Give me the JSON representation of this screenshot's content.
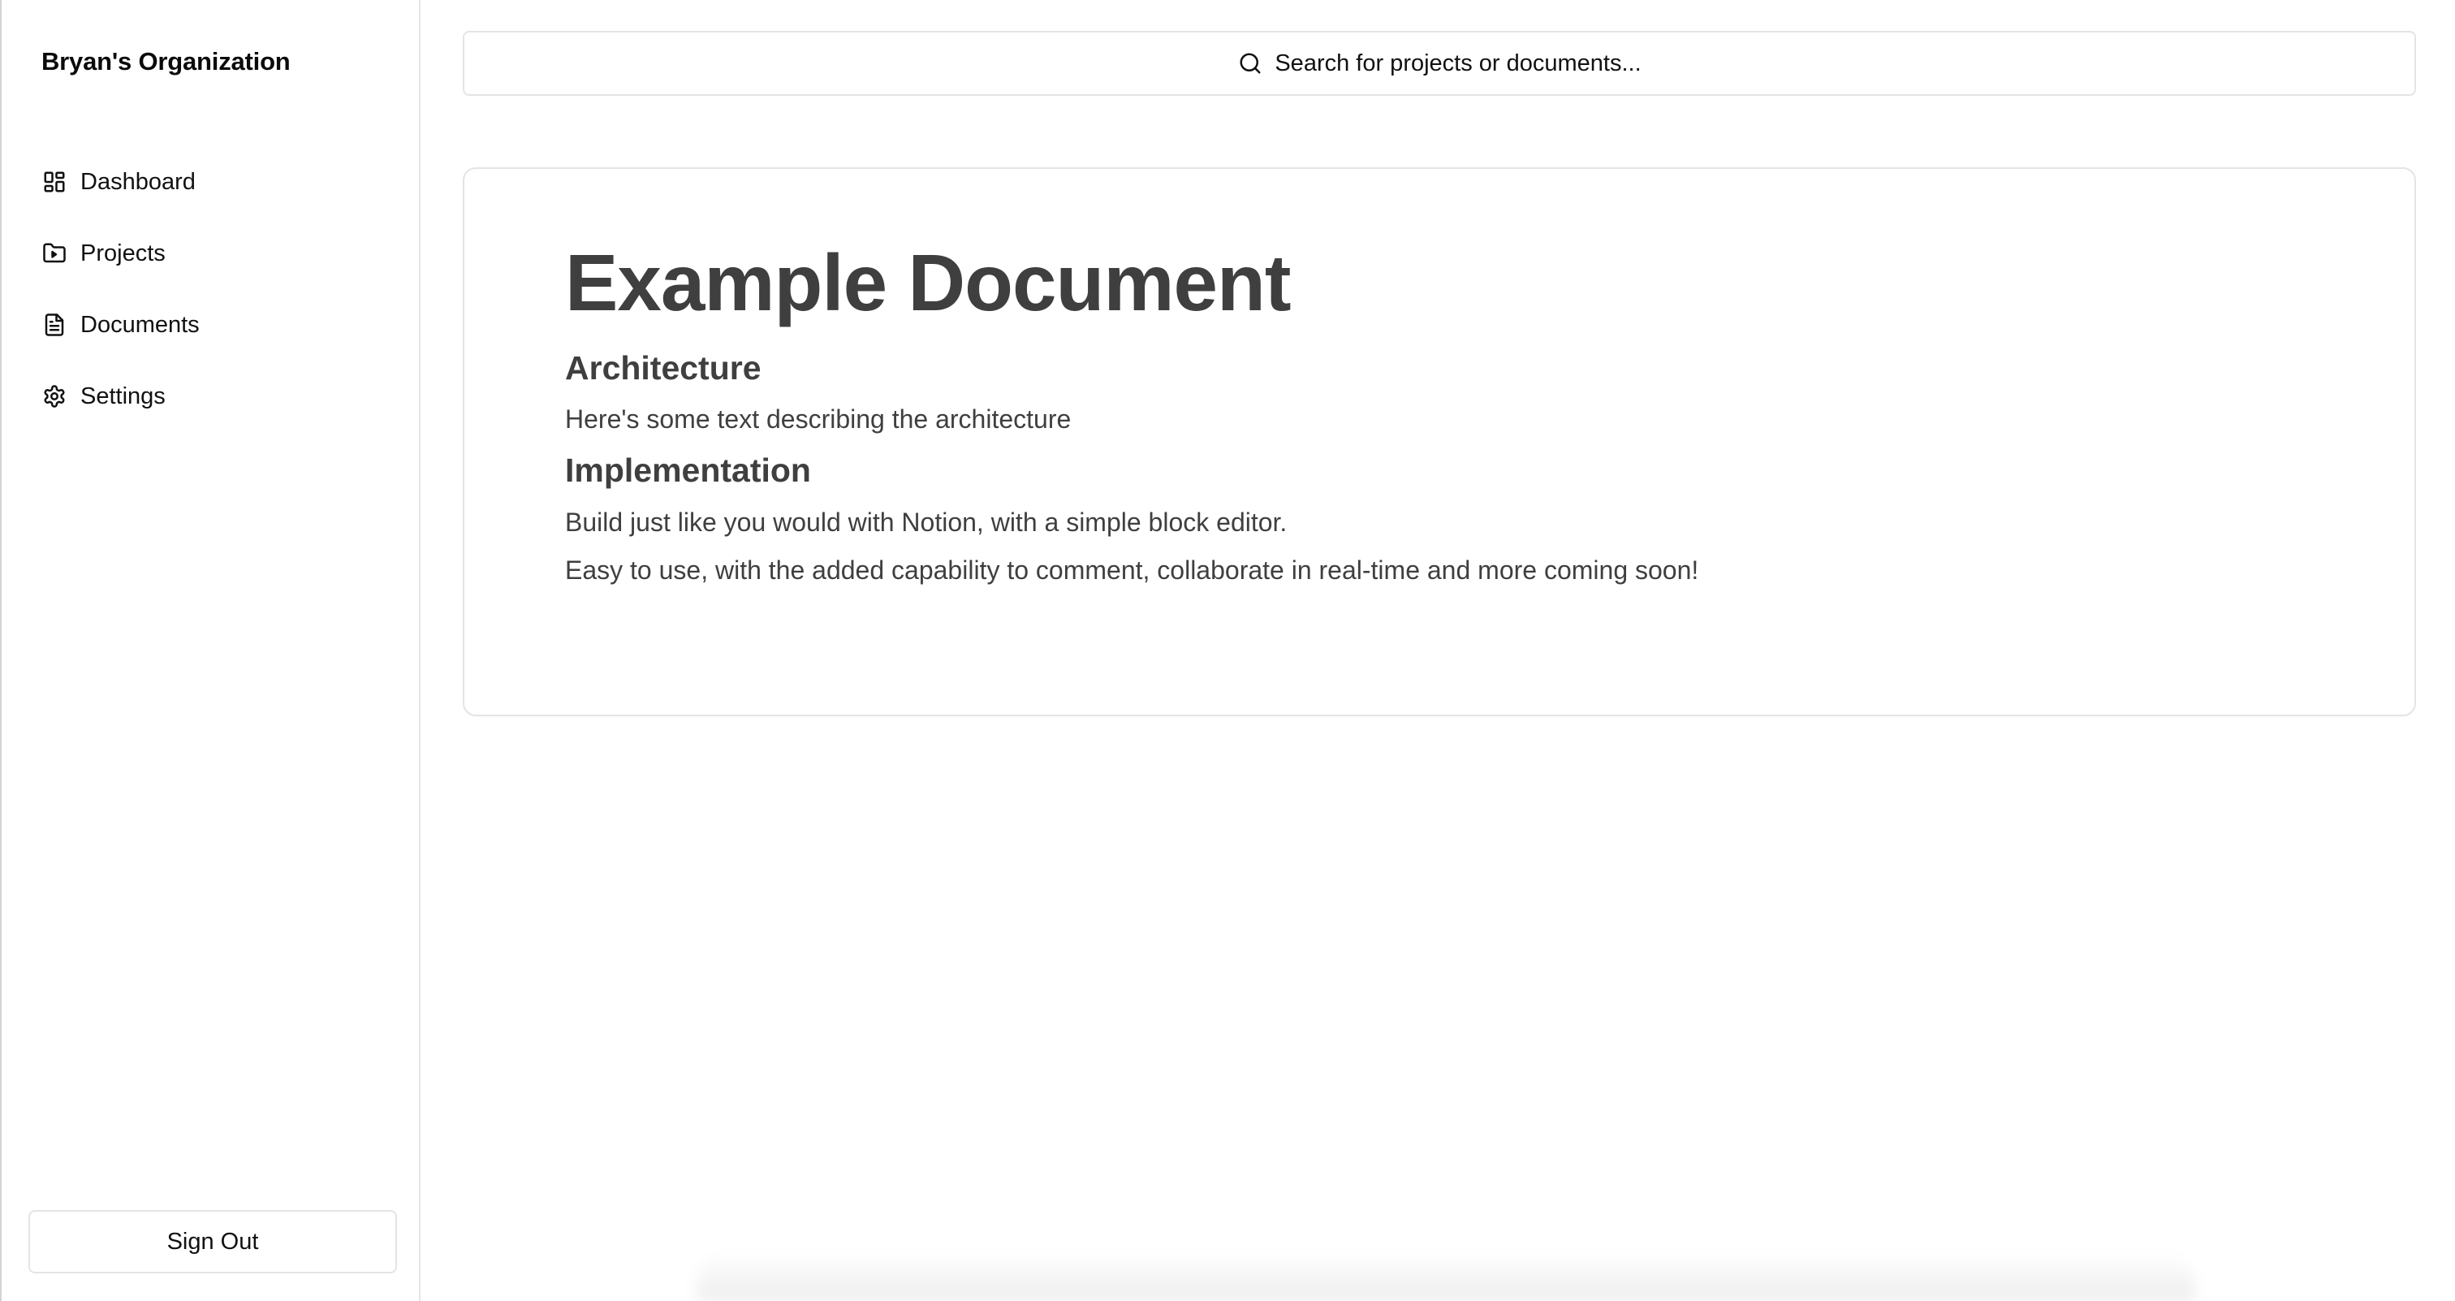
{
  "sidebar": {
    "org_name": "Bryan's Organization",
    "items": [
      {
        "label": "Dashboard",
        "icon": "dashboard-icon"
      },
      {
        "label": "Projects",
        "icon": "folder-icon"
      },
      {
        "label": "Documents",
        "icon": "document-icon"
      },
      {
        "label": "Settings",
        "icon": "gear-icon"
      }
    ],
    "sign_out_label": "Sign Out"
  },
  "search": {
    "placeholder": "Search for projects or documents...",
    "icon": "search-icon"
  },
  "document": {
    "title": "Example Document",
    "sections": [
      {
        "heading": "Architecture",
        "paragraphs": [
          "Here's some text describing the architecture"
        ]
      },
      {
        "heading": "Implementation",
        "paragraphs": [
          "Build just like you would with Notion, with a simple block editor.",
          "Easy to use, with the added capability to comment, collaborate in real-time and more coming soon!"
        ]
      }
    ]
  },
  "colors": {
    "text": "#111111",
    "doc_text": "#3f3f3f",
    "border": "#e4e4e7"
  }
}
